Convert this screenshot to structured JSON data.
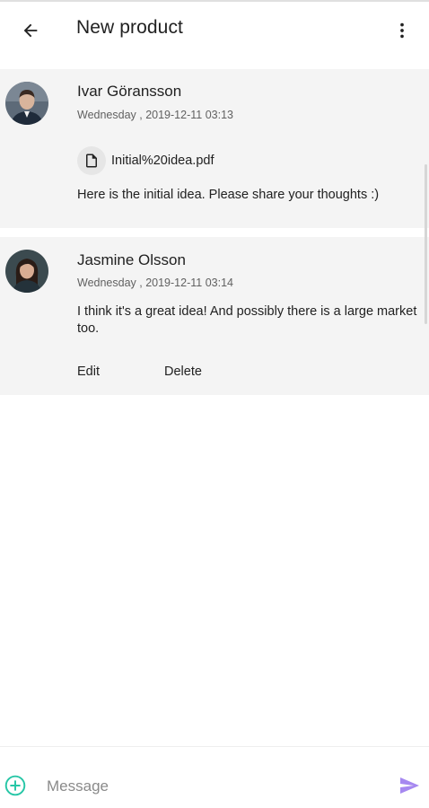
{
  "header": {
    "title": "New product",
    "back_icon": "arrow-back-icon",
    "menu_icon": "more-vert-icon"
  },
  "messages": [
    {
      "author": "Ivar Göransson",
      "timestamp": "Wednesday , 2019-12-11 03:13",
      "attachment": "Initial%20idea.pdf",
      "text": "Here is the initial idea. Please share your thoughts :)"
    },
    {
      "author": "Jasmine Olsson",
      "timestamp": "Wednesday , 2019-12-11 03:14",
      "text": "I think it's a great idea! And possibly there is a large market too.",
      "actions": {
        "edit": "Edit",
        "delete": "Delete"
      }
    }
  ],
  "composer": {
    "placeholder": "Message",
    "value": "",
    "add_icon": "add-circle-icon",
    "send_icon": "send-icon"
  },
  "colors": {
    "card_background": "#f4f4f4",
    "add_icon": "#26c6a6",
    "send_icon": "#a688f0"
  }
}
